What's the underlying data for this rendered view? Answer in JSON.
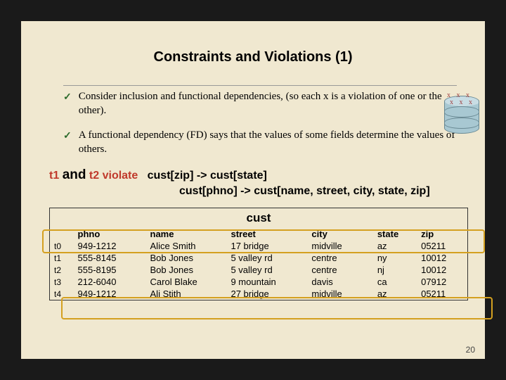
{
  "title": "Constraints and Violations (1)",
  "bullets": [
    "Consider inclusion and functional dependencies, (so each x is a violation of one or the other).",
    "A functional dependency (FD) says that the values of some fields determine the values of others."
  ],
  "violate": {
    "prefix": "t1",
    "and": "and",
    "t2": "t2 violate",
    "fd1": "cust[zip]   -> cust[state]",
    "fd2": "cust[phno] -> cust[name, street, city, state, zip]"
  },
  "table": {
    "name": "cust",
    "headers": {
      "phno": "phno",
      "name": "name",
      "street": "street",
      "city": "city",
      "state": "state",
      "zip": "zip"
    },
    "rows": [
      {
        "id": "t0",
        "phno": "949-1212",
        "name": "Alice Smith",
        "street": "17 bridge",
        "city": "midville",
        "state": "az",
        "zip": "05211"
      },
      {
        "id": "t1",
        "phno": "555-8145",
        "name": "Bob Jones",
        "street": "5 valley rd",
        "city": "centre",
        "state": "ny",
        "zip": "10012"
      },
      {
        "id": "t2",
        "phno": "555-8195",
        "name": "Bob Jones",
        "street": "5 valley rd",
        "city": "centre",
        "state": "nj",
        "zip": "10012"
      },
      {
        "id": "t3",
        "phno": "212-6040",
        "name": "Carol Blake",
        "street": "9 mountain",
        "city": "davis",
        "state": "ca",
        "zip": "07912"
      },
      {
        "id": "t4",
        "phno": "949-1212",
        "name": "Ali Stith",
        "street": "27 bridge",
        "city": "midville",
        "state": "az",
        "zip": "05211"
      }
    ]
  },
  "page": "20"
}
